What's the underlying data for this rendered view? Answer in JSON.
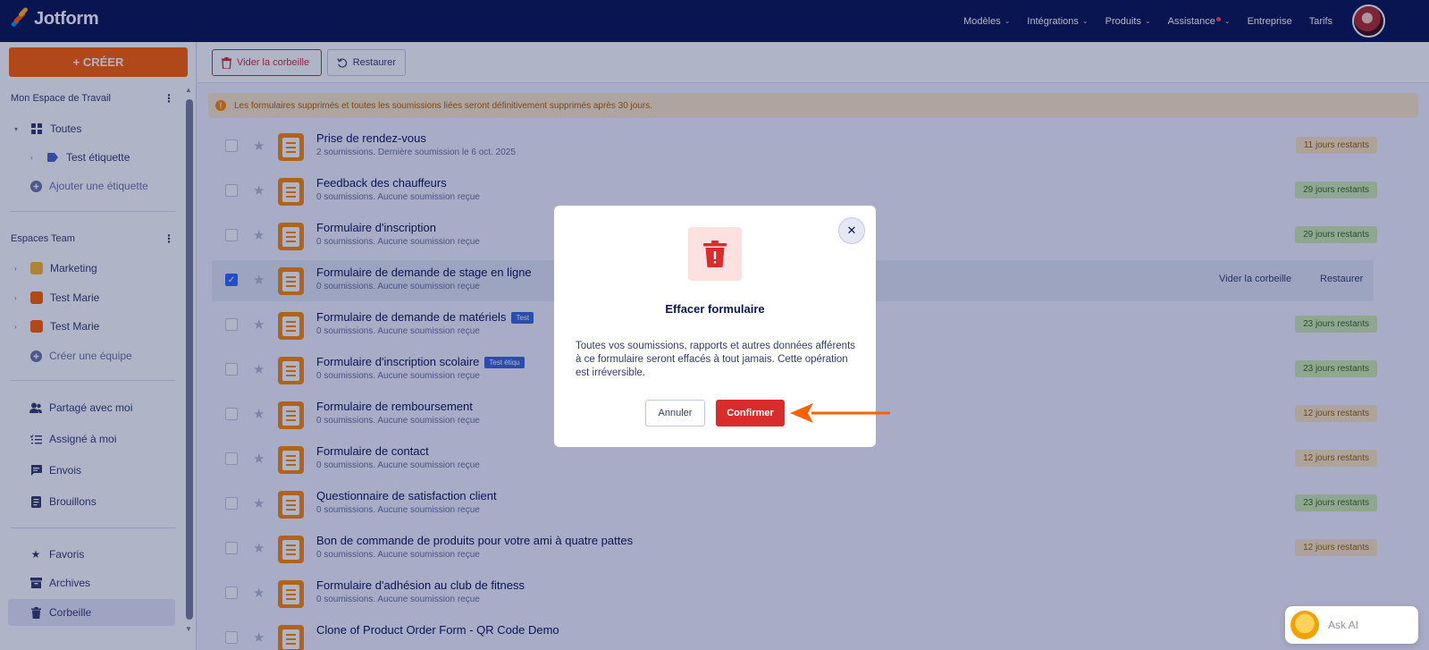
{
  "app": {
    "name": "Jotform"
  },
  "topnav": [
    {
      "label": "Modèles",
      "dropdown": true
    },
    {
      "label": "Intégrations",
      "dropdown": true
    },
    {
      "label": "Produits",
      "dropdown": true
    },
    {
      "label": "Assistance",
      "dropdown": true,
      "notification": true
    },
    {
      "label": "Entreprise",
      "dropdown": false
    },
    {
      "label": "Tarifs",
      "dropdown": false
    }
  ],
  "sidebar": {
    "create_label": "+ CRÉER",
    "workspace_title": "Mon Espace de Travail",
    "all_label": "Toutes",
    "tag_label": "Test étiquette",
    "add_tag_label": "Ajouter une étiquette",
    "teams_title": "Espaces Team",
    "teams": [
      "Marketing",
      "Test Marie",
      "Test Marie"
    ],
    "create_team_label": "Créer une équipe",
    "shared_label": "Partagé avec moi",
    "assigned_label": "Assigné à moi",
    "sent_label": "Envois",
    "drafts_label": "Brouillons",
    "favorites_label": "Favoris",
    "archives_label": "Archives",
    "trash_label": "Corbeille"
  },
  "toolbar": {
    "empty_trash_label": "Vider la corbeille",
    "restore_label": "Restaurer"
  },
  "warning_text": "Les formulaires supprimés et toutes les soumissions liées seront définitivement supprimés après 30 jours.",
  "forms": [
    {
      "title": "Prise de rendez-vous",
      "subtitle": "2 soumissions. Dernière soumission le 6 oct. 2025",
      "days": "11 jours restants",
      "days_color": "orange",
      "checked": false
    },
    {
      "title": "Feedback des chauffeurs",
      "subtitle": "0 soumissions. Aucune soumission reçue",
      "days": "29 jours restants",
      "days_color": "green",
      "checked": false
    },
    {
      "title": "Formulaire d'inscription",
      "subtitle": "0 soumissions. Aucune soumission reçue",
      "days": "29 jours restants",
      "days_color": "green",
      "checked": false
    },
    {
      "title": "Formulaire de demande de stage en ligne",
      "subtitle": "0 soumissions. Aucune soumission reçue",
      "days": "",
      "days_color": "",
      "checked": true,
      "actions": [
        "Vider la corbeille",
        "Restaurer"
      ]
    },
    {
      "title": "Formulaire de demande de matériels",
      "subtitle": "0 soumissions. Aucune soumission reçue",
      "tag": "Test",
      "days": "23 jours restants",
      "days_color": "green",
      "checked": false
    },
    {
      "title": "Formulaire d'inscription scolaire",
      "subtitle": "0 soumissions. Aucune soumission reçue",
      "tag": "Test étiqu",
      "days": "23 jours restants",
      "days_color": "green",
      "checked": false
    },
    {
      "title": "Formulaire de remboursement",
      "subtitle": "0 soumissions. Aucune soumission reçue",
      "days": "12 jours restants",
      "days_color": "orange",
      "checked": false
    },
    {
      "title": "Formulaire de contact",
      "subtitle": "0 soumissions. Aucune soumission reçue",
      "days": "12 jours restants",
      "days_color": "orange",
      "checked": false
    },
    {
      "title": "Questionnaire de satisfaction client",
      "subtitle": "0 soumissions. Aucune soumission reçue",
      "days": "23 jours restants",
      "days_color": "green",
      "checked": false
    },
    {
      "title": "Bon de commande de produits pour votre ami à quatre pattes",
      "subtitle": "0 soumissions. Aucune soumission reçue",
      "days": "12 jours restants",
      "days_color": "orange",
      "checked": false
    },
    {
      "title": "Formulaire d'adhésion au club de fitness",
      "subtitle": "0 soumissions. Aucune soumission reçue",
      "days": "",
      "days_color": "",
      "checked": false
    },
    {
      "title": "Clone of Product Order Form - QR Code Demo",
      "subtitle": "",
      "days": "",
      "days_color": "",
      "checked": false
    }
  ],
  "modal": {
    "title": "Effacer formulaire",
    "text": "Toutes vos soumissions, rapports et autres données afférents à ce formulaire seront effacés à tout jamais. Cette opération est irréversible.",
    "cancel_label": "Annuler",
    "confirm_label": "Confirmer"
  },
  "ask_ai_label": "Ask AI",
  "colors": {
    "brand_dark": "#0a1551",
    "brand_orange": "#ff6100",
    "danger": "#d92c2c",
    "annotation_arrow": "#ff6100"
  }
}
